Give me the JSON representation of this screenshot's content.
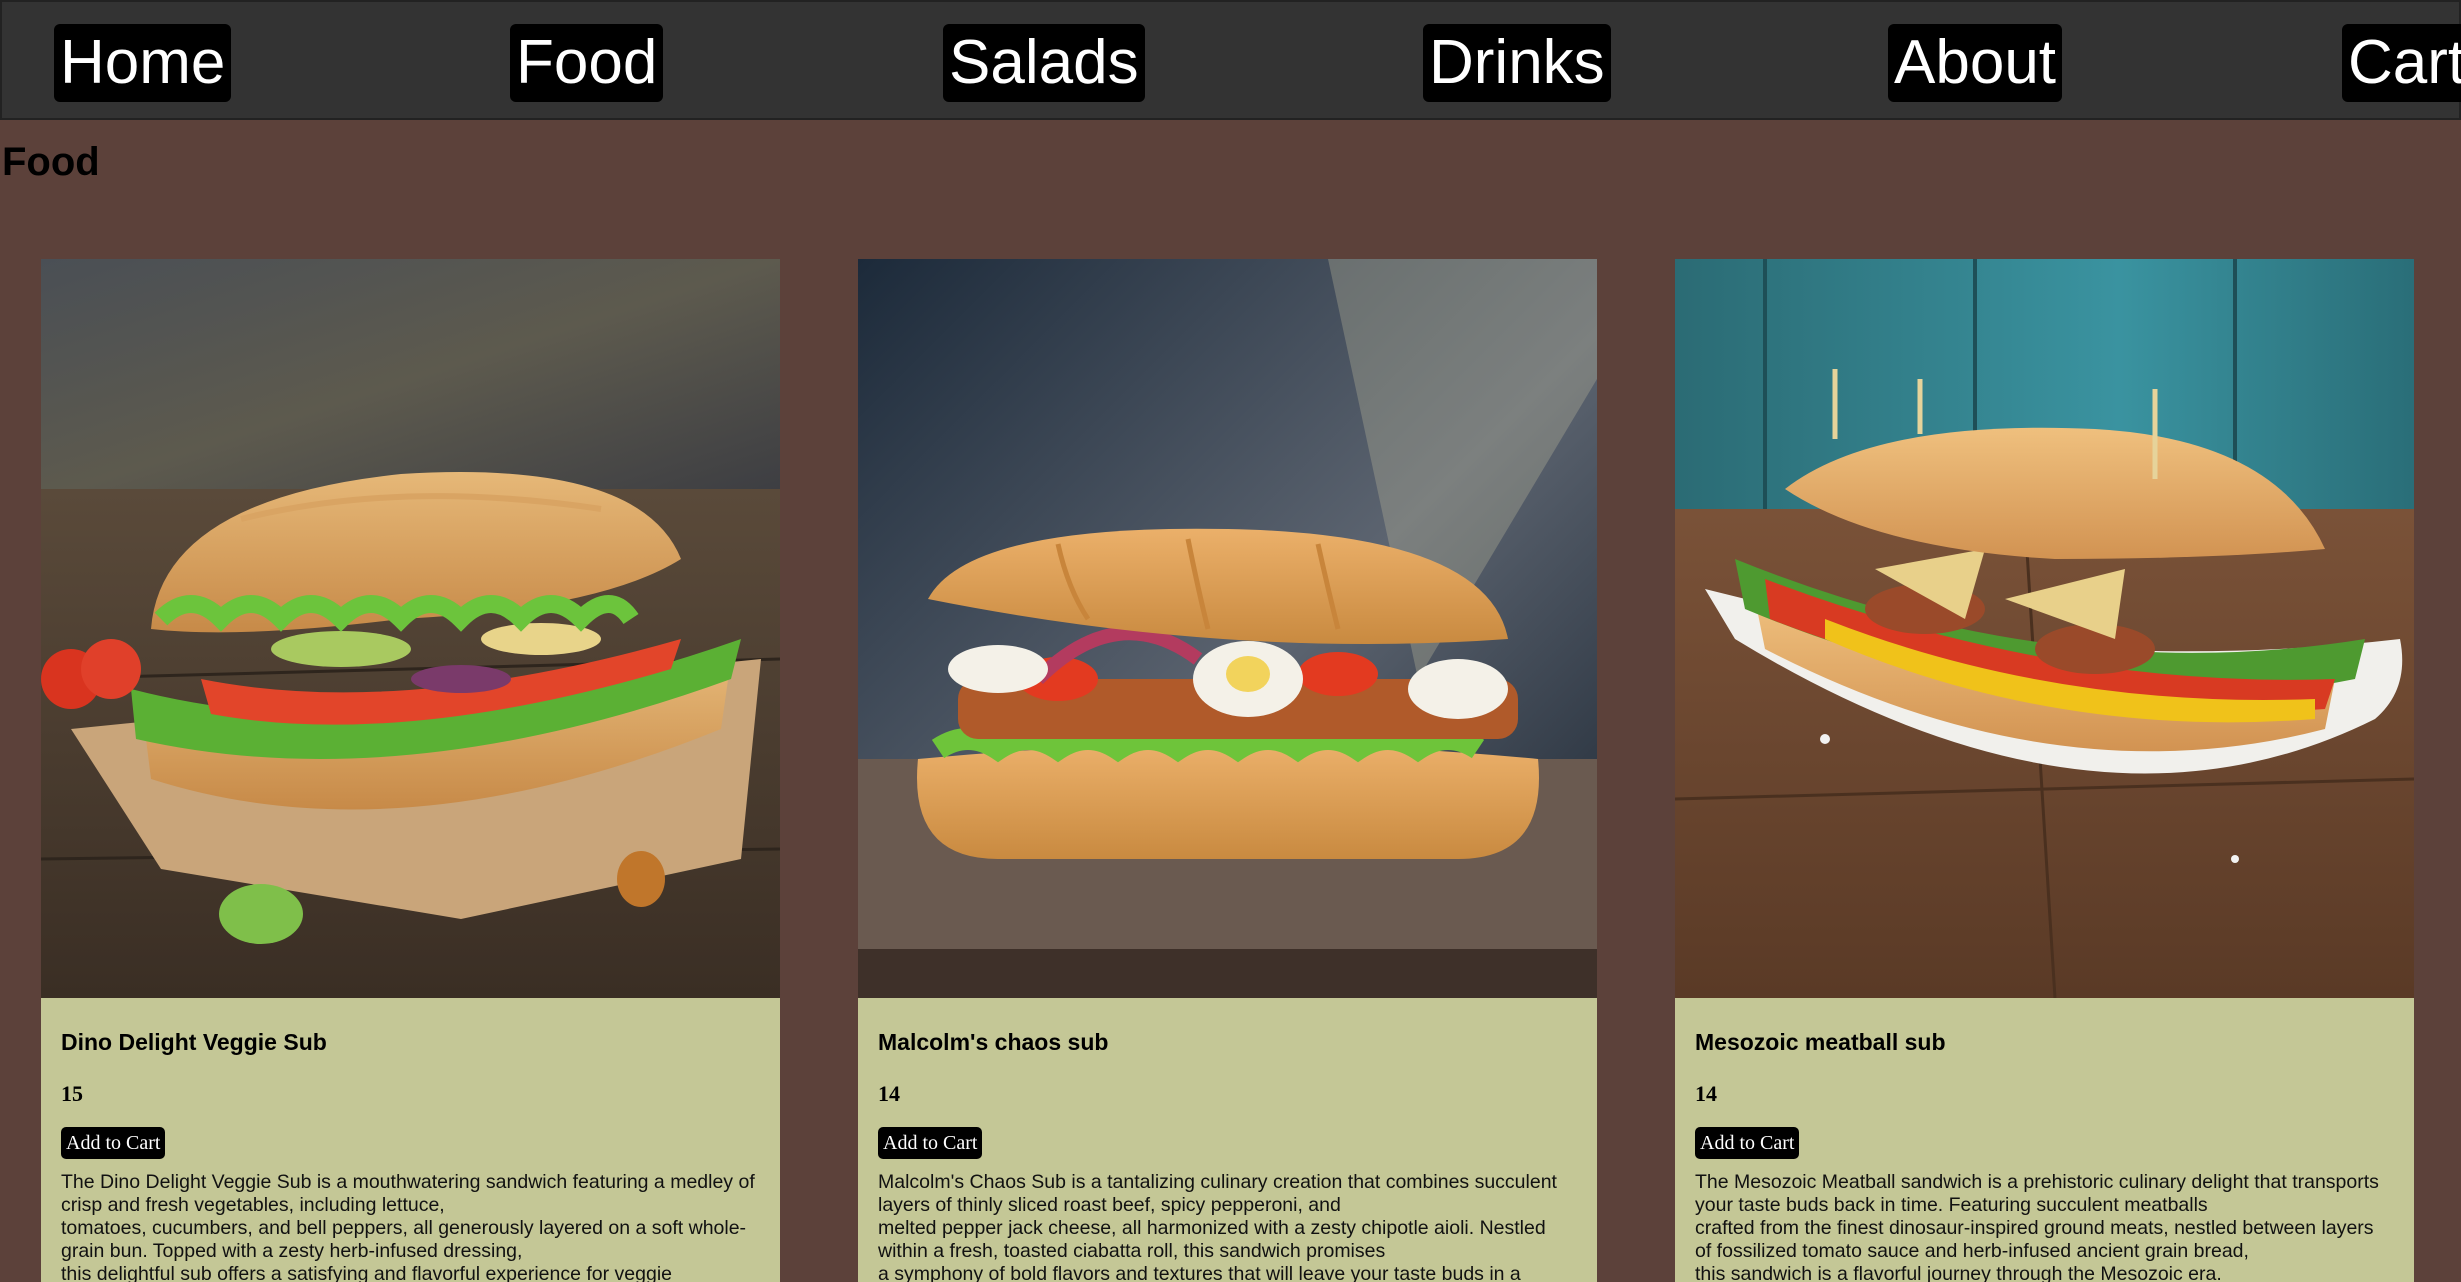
{
  "nav": {
    "home": "Home",
    "food": "Food",
    "salads": "Salads",
    "drinks": "Drinks",
    "about": "About",
    "cart": "Cart"
  },
  "page": {
    "title": "Food"
  },
  "products": [
    {
      "name": "Dino Delight Veggie Sub",
      "price": "15",
      "button": "Add to Cart",
      "description": "The Dino Delight Veggie Sub is a mouthwatering sandwich featuring a medley of crisp and fresh vegetables, including lettuce,\ntomatoes, cucumbers, and bell peppers, all generously layered on a soft whole-grain bun. Topped with a zesty herb-infused dressing,\nthis delightful sub offers a satisfying and flavorful experience for veggie"
    },
    {
      "name": "Malcolm's chaos sub",
      "price": "14",
      "button": "Add to Cart",
      "description": "Malcolm's Chaos Sub is a tantalizing culinary creation that combines succulent layers of thinly sliced roast beef, spicy pepperoni, and\nmelted pepper jack cheese, all harmonized with a zesty chipotle aioli. Nestled within a fresh, toasted ciabatta roll, this sandwich promises\na symphony of bold flavors and textures that will leave your taste buds in a"
    },
    {
      "name": "Mesozoic meatball sub",
      "price": "14",
      "button": "Add to Cart",
      "description": "The Mesozoic Meatball sandwich is a prehistoric culinary delight that transports your taste buds back in time. Featuring succulent meatballs\ncrafted from the finest dinosaur-inspired ground meats, nestled between layers of fossilized tomato sauce and herb-infused ancient grain bread,\nthis sandwich is a flavorful journey through the Mesozoic era."
    }
  ],
  "colors": {
    "page_bg": "#5c413a",
    "nav_bg": "#333333",
    "card_bg": "#c4c796",
    "button_bg": "#000000"
  }
}
